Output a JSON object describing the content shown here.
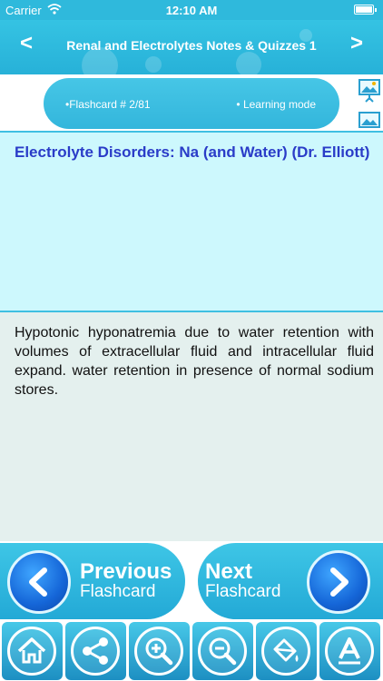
{
  "status_bar": {
    "carrier": "Carrier",
    "time": "12:10 AM"
  },
  "header": {
    "title": "Renal and Electrolytes Notes & Quizzes 1",
    "prev_arrow": "<",
    "next_arrow": ">"
  },
  "info_bar": {
    "flashcard_label": "•Flashcard #  2/81",
    "mode_label": "• Learning mode"
  },
  "card": {
    "title": "Electrolyte Disorders: Na (and Water) (Dr. Elliott)",
    "body": "Hypotonic hyponatremia due to water retention with volumes of extracellular fluid and intracellular fluid expand. water retention in presence of normal sodium stores."
  },
  "nav_buttons": {
    "previous_big": "Previous",
    "previous_small": "Flashcard",
    "next_big": "Next",
    "next_small": "Flashcard"
  },
  "toolbar": {
    "items": [
      "home-icon",
      "share-icon",
      "zoom-in-icon",
      "zoom-out-icon",
      "paint-bucket-icon",
      "font-icon"
    ]
  },
  "colors": {
    "header": "#2fb9dc",
    "card_title": "#2a3cc8",
    "title_panel": "#cdf8fd",
    "body_panel": "#e4f0ee",
    "nav_circle": "#1566d8"
  }
}
